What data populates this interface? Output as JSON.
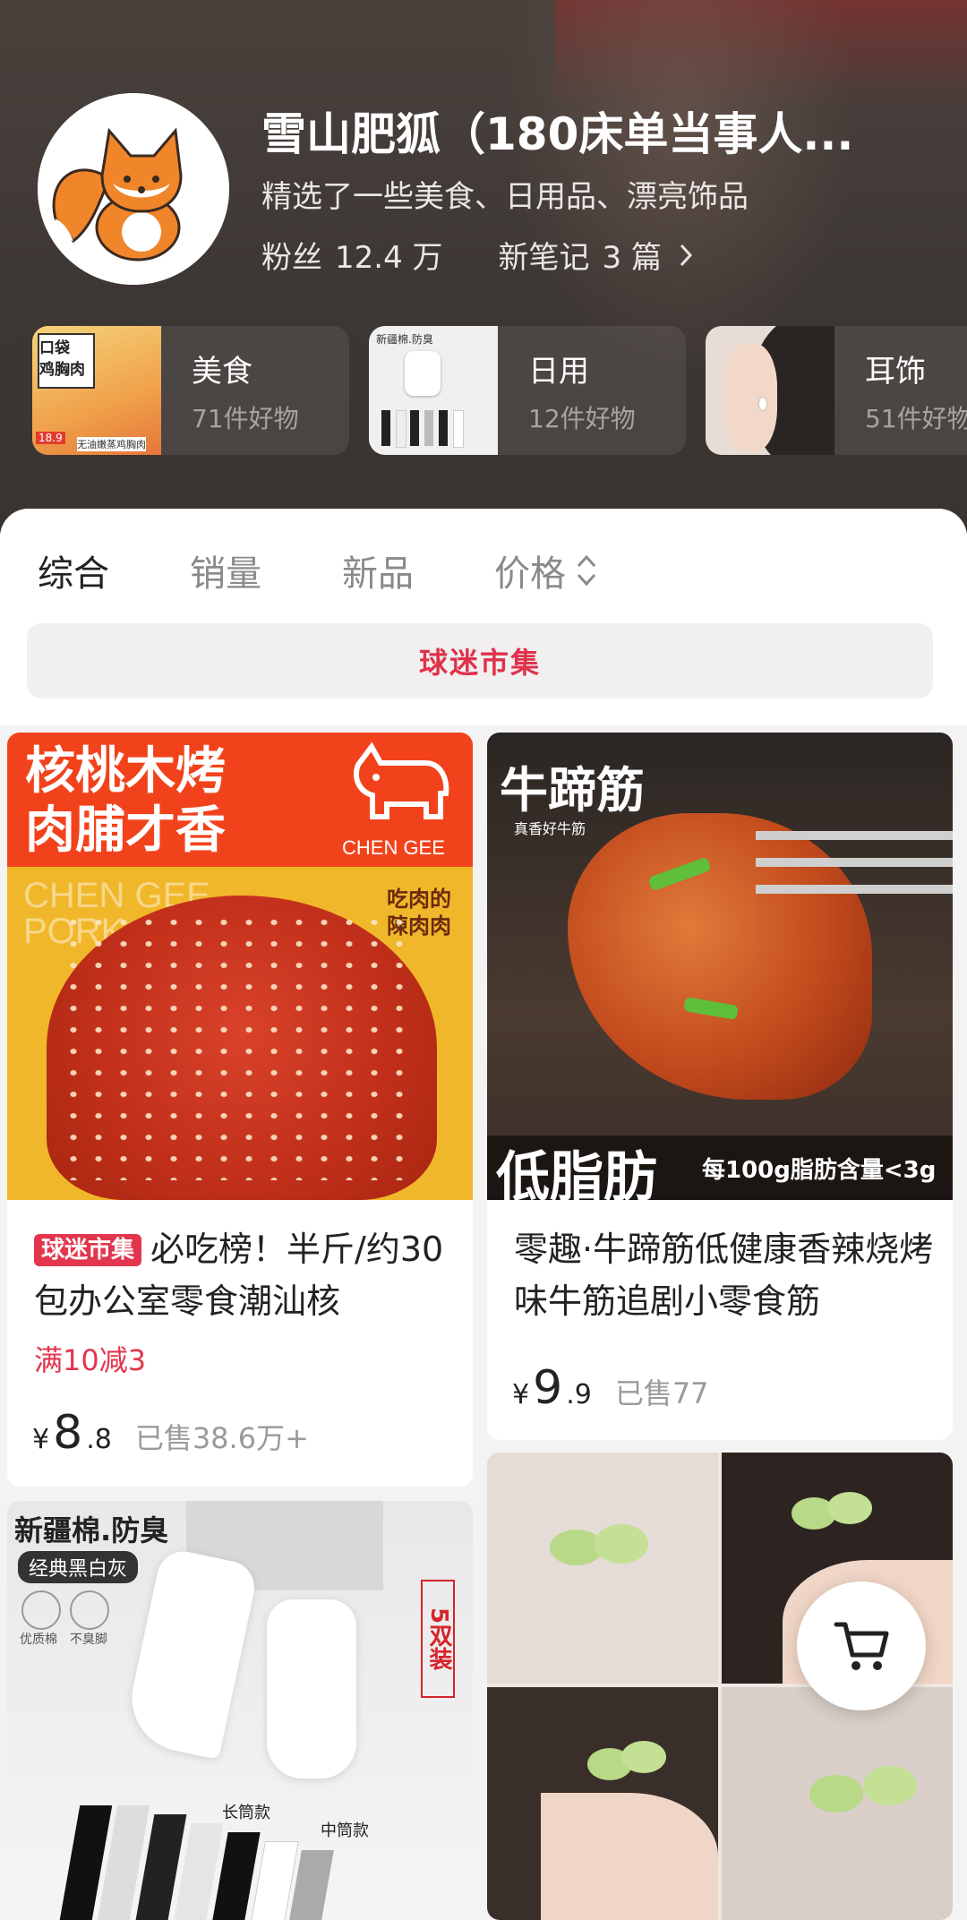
{
  "shop": {
    "name": "雪山肥狐（180床单当事人...",
    "description": "精选了一些美食、日用品、漂亮饰品",
    "fans_label": "粉丝",
    "fans_value": "12.4 万",
    "notes_label": "新笔记",
    "notes_value": "3 篇"
  },
  "categories": [
    {
      "title": "美食",
      "count": "71件好物",
      "thumb_text_1": "口袋",
      "thumb_text_2": "鸡胸肉",
      "thumb_price": "18.9",
      "thumb_caption": "无油嫩蒸鸡胸肉"
    },
    {
      "title": "日用",
      "count": "12件好物",
      "thumb_text_1": "新疆棉.防臭"
    },
    {
      "title": "耳饰",
      "count": "51件好物"
    }
  ],
  "sort_tabs": [
    {
      "label": "综合",
      "active": true
    },
    {
      "label": "销量",
      "active": false
    },
    {
      "label": "新品",
      "active": false
    },
    {
      "label": "价格",
      "active": false
    }
  ],
  "banner": "球迷市集",
  "products": [
    {
      "img_line1": "核桃木烤",
      "img_line2": "肉脯才香",
      "img_brand": "CHEN GEE",
      "img_watermark_1": "CHEN GEE",
      "img_watermark_2": "PORK",
      "img_slogan_1": "吃肉的",
      "img_slogan_2": "陳肉肉",
      "tag": "球迷市集",
      "title": "必吃榜！半斤/约30包办公室零食潮汕核",
      "promo": "满10减3",
      "currency": "¥",
      "price_int": "8",
      "price_dec": ".8",
      "sold": "已售38.6万+"
    },
    {
      "img_title": "牛蹄筋",
      "img_subtitle": "真香好牛筋",
      "img_bottom": "低脂肪",
      "img_note": "每100g脂肪含量<3g",
      "title": "零趣·牛蹄筋低健康香辣烧烤味牛筋追剧小零食筋",
      "currency": "¥",
      "price_int": "9",
      "price_dec": ".9",
      "sold": "已售77"
    },
    {
      "img_title": "新疆棉.防臭",
      "img_badge": "经典黑白灰",
      "img_icon1": "优质棉",
      "img_icon2": "不臭脚",
      "img_side": "5双装",
      "img_label_long": "长筒款",
      "img_label_mid": "中筒款"
    },
    {
      "img_desc": "green flower hair clips"
    }
  ],
  "icons": {
    "cart": "shopping-cart-icon",
    "chevron": "chevron-right-icon",
    "sort": "sort-updown-icon"
  }
}
